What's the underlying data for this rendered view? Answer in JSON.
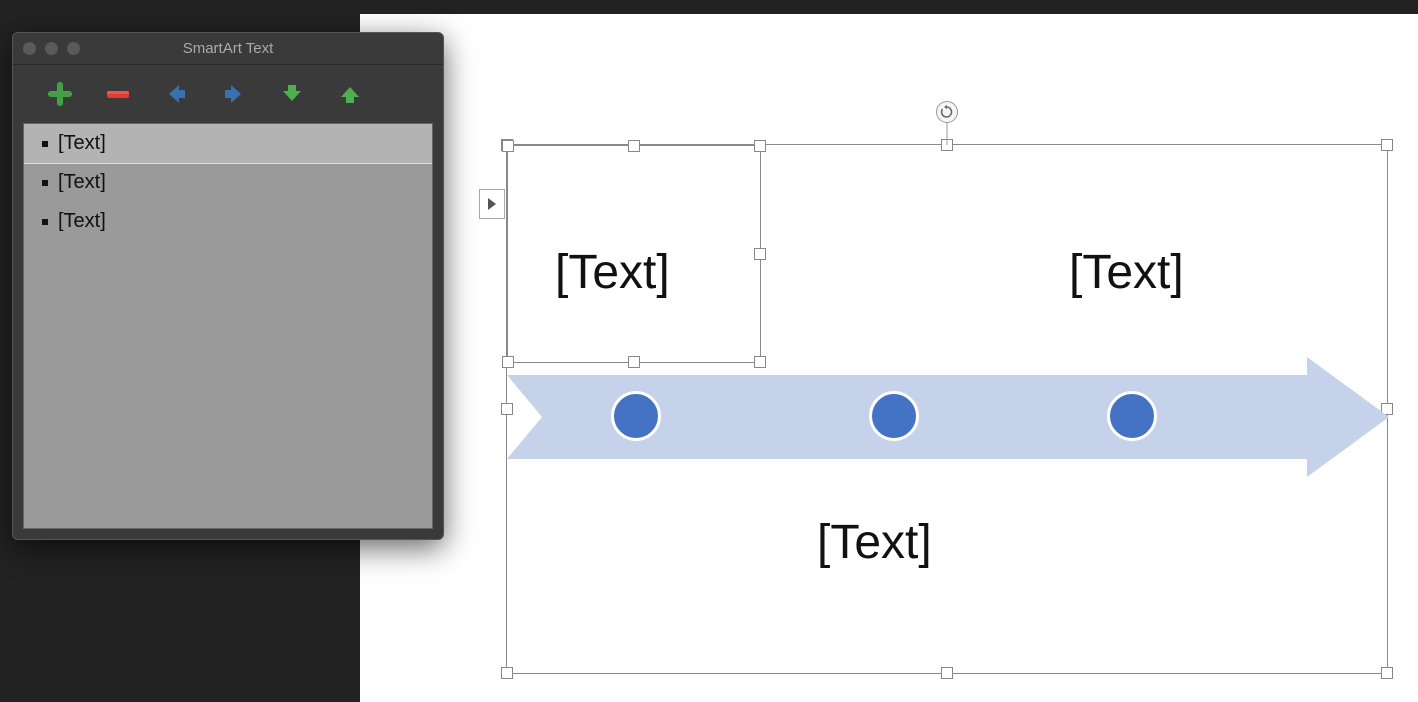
{
  "panel": {
    "title": "SmartArt Text",
    "items": [
      {
        "text": "[Text]",
        "selected": true
      },
      {
        "text": "[Text]",
        "selected": false
      },
      {
        "text": "[Text]",
        "selected": false
      }
    ]
  },
  "toolbar": {
    "add": "add",
    "remove": "remove",
    "promote": "promote",
    "demote": "demote",
    "move_down": "move down",
    "move_up": "move up"
  },
  "diagram": {
    "labels": {
      "top_left": "[Text]",
      "top_right": "[Text]",
      "bottom_mid": "[Text]"
    }
  },
  "colors": {
    "arrow_fill": "#c6d1ea",
    "dot_fill": "#4472c4"
  }
}
